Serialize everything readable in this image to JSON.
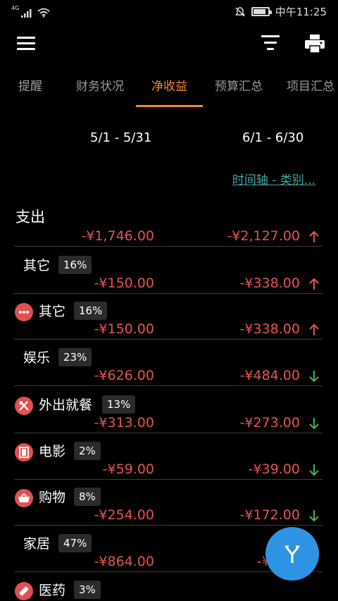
{
  "status": {
    "network": "4G",
    "time": "中午11:25",
    "battery_level": 0.85
  },
  "tabs": [
    "提醒",
    "财务状况",
    "净收益",
    "预算汇总",
    "项目汇总"
  ],
  "active_tab": "净收益",
  "periods": [
    "5/1 - 5/31",
    "6/1 - 6/30"
  ],
  "timeline_link": "时间轴 - 类别...",
  "section": {
    "title": "支出",
    "total_p1": "-¥1,746.00",
    "total_p2": "-¥2,127.00",
    "trend": "up"
  },
  "rows": [
    {
      "label": "其它",
      "pct": "16%",
      "p1": "-¥150.00",
      "p2": "-¥338.00",
      "trend": "up",
      "icon": ""
    },
    {
      "label": "其它",
      "pct": "16%",
      "p1": "-¥150.00",
      "p2": "-¥338.00",
      "trend": "up",
      "icon": "more-icon"
    },
    {
      "label": "娱乐",
      "pct": "23%",
      "p1": "-¥626.00",
      "p2": "-¥484.00",
      "trend": "down",
      "icon": ""
    },
    {
      "label": "外出就餐",
      "pct": "13%",
      "p1": "-¥313.00",
      "p2": "-¥273.00",
      "trend": "down",
      "icon": "utensils-icon"
    },
    {
      "label": "电影",
      "pct": "2%",
      "p1": "-¥59.00",
      "p2": "-¥39.00",
      "trend": "down",
      "icon": "film-icon"
    },
    {
      "label": "购物",
      "pct": "8%",
      "p1": "-¥254.00",
      "p2": "-¥172.00",
      "trend": "down",
      "icon": "basket-icon"
    },
    {
      "label": "家居",
      "pct": "47%",
      "p1": "-¥864.00",
      "p2": "-¥1,00",
      "trend": "up",
      "icon": ""
    },
    {
      "label": "医药",
      "pct": "3%",
      "p1": "",
      "p2": "",
      "trend": "",
      "icon": "medical-icon"
    }
  ],
  "colors": {
    "accent": "#f08a3c",
    "negative": "#e45454",
    "up": "#e45454",
    "down": "#4caf50",
    "link": "#3fa7a0",
    "fab": "#2f93e3",
    "icon_bg": "#e35050"
  }
}
